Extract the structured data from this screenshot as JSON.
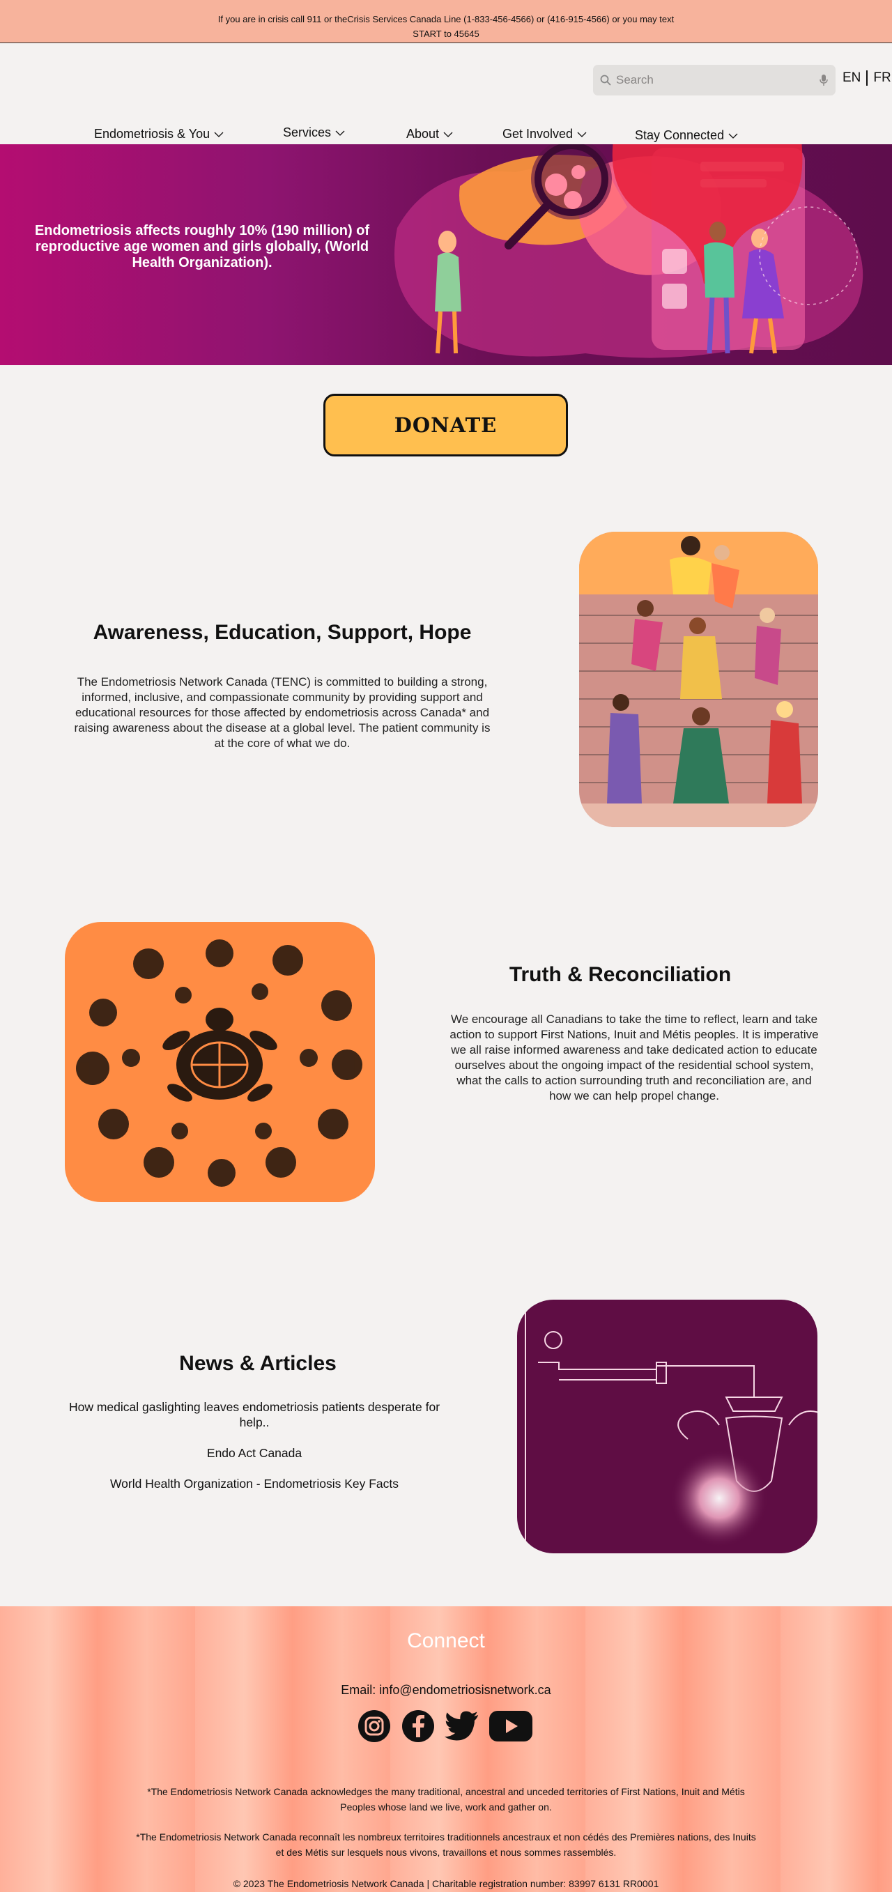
{
  "crisis_banner": {
    "line1": "If you are in crisis call 911 or  theCrisis Services Canada Line (1-833-456-4566) or (416-915-4566) or you may text",
    "line2": "START to 45645"
  },
  "header": {
    "search_placeholder": "Search",
    "lang_en": "EN",
    "lang_fr": "FR",
    "nav": [
      {
        "label": "Endometriosis & You"
      },
      {
        "label": "Services"
      },
      {
        "label": "About"
      },
      {
        "label": "Get Involved"
      },
      {
        "label": "Stay Connected"
      }
    ]
  },
  "hero": {
    "text": "Endometriosis affects roughly 10% (190 million) of reproductive age women and girls globally, (World Health Organization)."
  },
  "donate": {
    "label": "DONATE"
  },
  "awareness": {
    "title": "Awareness, Education, Support, Hope",
    "body": "The Endometriosis Network Canada (TENC) is committed to building a strong, informed, inclusive, and compassionate community by providing support and educational resources for those affected by endometriosis across Canada* and raising awareness about the disease at a global level. The patient community is at the core of what we do."
  },
  "truth": {
    "title": "Truth & Reconciliation",
    "body": "We encourage all Canadians to take the time to reflect, learn and take action to support First Nations, Inuit and Métis peoples. It is imperative we all raise  informed awareness and take dedicated action to educate ourselves about the ongoing impact of the residential school system, what the calls to action surrounding truth and reconciliation are, and how we can help propel change."
  },
  "news": {
    "title": "News & Articles",
    "links": [
      "How medical gaslighting leaves endometriosis patients desperate for help..",
      "Endo Act Canada",
      "World Health Organization - Endometriosis Key Facts"
    ]
  },
  "footer": {
    "connect": "Connect",
    "email": "Email: info@endometriosisnetwork.ca",
    "socials": [
      "instagram-icon",
      "facebook-icon",
      "twitter-icon",
      "youtube-icon"
    ],
    "ack_en": "*The Endometriosis Network Canada acknowledges the many traditional, ancestral and unceded territories of First Nations, Inuit and Métis Peoples whose land we live, work and gather on.",
    "ack_fr": "*The Endometriosis Network Canada reconnaît les nombreux territoires traditionnels ancestraux et non cédés des Premières nations, des Inuits et des Métis sur lesquels nous vivons, travaillons et nous sommes rassemblés.",
    "copyright": "© 2023 The Endometriosis Network Canada | Charitable registration number: 83997 6131 RR0001"
  },
  "colors": {
    "banner": "#f7b39c",
    "donate": "#ffbf4f",
    "hero_start": "#b40d71",
    "hero_end": "#5e0d4c",
    "card_orange": "#ff8c44",
    "card_plum": "#5f0d44"
  }
}
